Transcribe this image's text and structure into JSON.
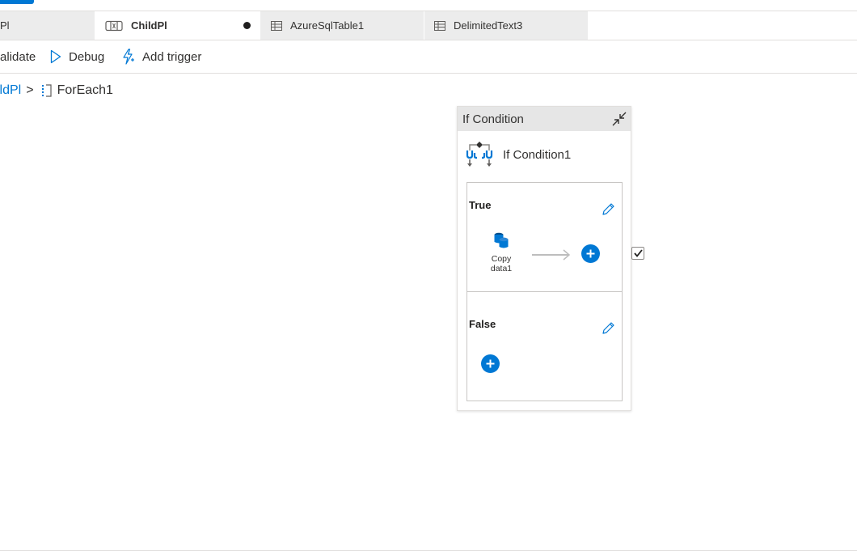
{
  "tabs": [
    {
      "label": "Pl",
      "active": false
    },
    {
      "label": "ChildPl",
      "active": true,
      "dirty": true
    },
    {
      "label": "AzureSqlTable1",
      "active": false
    },
    {
      "label": "DelimitedText3",
      "active": false
    }
  ],
  "toolbar": {
    "validate_label": "alidate",
    "debug_label": "Debug",
    "add_trigger_label": "Add trigger"
  },
  "breadcrumb": {
    "parent": "ildPl",
    "separator": ">",
    "current": "ForEach1"
  },
  "if_condition": {
    "header_title": "If Condition",
    "activity_name": "If Condition1",
    "true_branch": {
      "label": "True",
      "activities": [
        {
          "label_line1": "Copy",
          "label_line2": "data1"
        }
      ]
    },
    "false_branch": {
      "label": "False"
    }
  },
  "colors": {
    "accent": "#0078d4",
    "tab_inactive_bg": "#ececec",
    "header_bg": "#e6e6e6"
  }
}
